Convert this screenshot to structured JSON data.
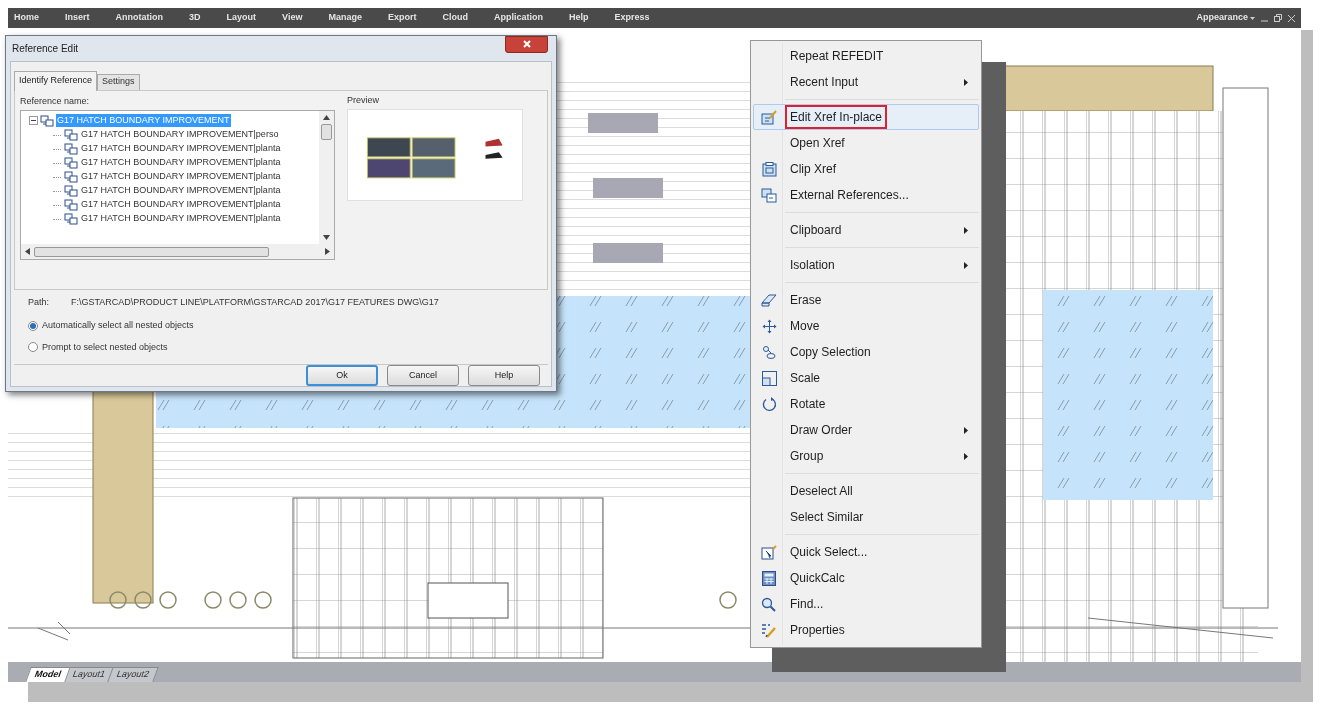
{
  "menu_bar": {
    "items": [
      "Home",
      "Insert",
      "Annotation",
      "3D",
      "Layout",
      "View",
      "Manage",
      "Export",
      "Cloud",
      "Application",
      "Help",
      "Express"
    ],
    "appearance": "Appearance"
  },
  "dialog": {
    "title": "Reference Edit",
    "tabs": [
      {
        "label": "Identify Reference",
        "selected": true
      },
      {
        "label": "Settings",
        "selected": false
      }
    ],
    "reference_name_label": "Reference name:",
    "tree": {
      "label": "G17 HATCH BOUNDARY IMPROVEMENT",
      "expanded": true,
      "selected": true,
      "children": [
        {
          "label": "G17 HATCH BOUNDARY IMPROVEMENT|perso",
          "selected": false
        },
        {
          "label": "G17 HATCH BOUNDARY IMPROVEMENT|planta",
          "selected": false
        },
        {
          "label": "G17 HATCH BOUNDARY IMPROVEMENT|planta",
          "selected": false
        },
        {
          "label": "G17 HATCH BOUNDARY IMPROVEMENT|planta",
          "selected": false
        },
        {
          "label": "G17 HATCH BOUNDARY IMPROVEMENT|planta",
          "selected": false
        },
        {
          "label": "G17 HATCH BOUNDARY IMPROVEMENT|planta",
          "selected": false
        },
        {
          "label": "G17 HATCH BOUNDARY IMPROVEMENT|planta",
          "selected": false
        }
      ]
    },
    "preview_label": "Preview",
    "path_label": "Path:",
    "path_value": "F:\\GSTARCAD\\PRODUCT LINE\\PLATFORM\\GSTARCAD 2017\\G17 FEATURES DWG\\G17",
    "options": [
      {
        "label": "Automatically select all nested objects",
        "selected": true
      },
      {
        "label": "Prompt to select nested objects",
        "selected": false
      }
    ],
    "buttons": [
      {
        "label": "Ok",
        "default": true
      },
      {
        "label": "Cancel",
        "default": false
      },
      {
        "label": "Help",
        "default": false
      }
    ]
  },
  "context_menu": {
    "groups": [
      [
        {
          "label": "Repeat REFEDIT",
          "submenu": false,
          "highlighted": false
        },
        {
          "label": "Recent Input",
          "submenu": true,
          "highlighted": false
        }
      ],
      [
        {
          "label": "Edit Xref In-place",
          "submenu": false,
          "highlighted": true
        },
        {
          "label": "Open Xref",
          "submenu": false,
          "highlighted": false
        },
        {
          "label": "Clip Xref",
          "submenu": false,
          "highlighted": false
        },
        {
          "label": "External References...",
          "submenu": false,
          "highlighted": false
        }
      ],
      [
        {
          "label": "Clipboard",
          "submenu": true,
          "highlighted": false
        }
      ],
      [
        {
          "label": "Isolation",
          "submenu": true,
          "highlighted": false
        }
      ],
      [
        {
          "label": "Erase",
          "submenu": false,
          "highlighted": false
        },
        {
          "label": "Move",
          "submenu": false,
          "highlighted": false
        },
        {
          "label": "Copy Selection",
          "submenu": false,
          "highlighted": false
        },
        {
          "label": "Scale",
          "submenu": false,
          "highlighted": false
        },
        {
          "label": "Rotate",
          "submenu": false,
          "highlighted": false
        },
        {
          "label": "Draw Order",
          "submenu": true,
          "highlighted": false
        },
        {
          "label": "Group",
          "submenu": true,
          "highlighted": false
        }
      ],
      [
        {
          "label": "Deselect All",
          "submenu": false,
          "highlighted": false
        },
        {
          "label": "Select Similar",
          "submenu": false,
          "highlighted": false
        }
      ],
      [
        {
          "label": "Quick Select...",
          "submenu": false,
          "highlighted": false
        },
        {
          "label": "QuickCalc",
          "submenu": false,
          "highlighted": false
        },
        {
          "label": "Find...",
          "submenu": false,
          "highlighted": false
        },
        {
          "label": "Properties",
          "submenu": false,
          "highlighted": false
        }
      ]
    ]
  },
  "layout_tabs": [
    {
      "label": "Model",
      "selected": true
    },
    {
      "label": "Layout1",
      "selected": false
    },
    {
      "label": "Layout2",
      "selected": false
    }
  ]
}
